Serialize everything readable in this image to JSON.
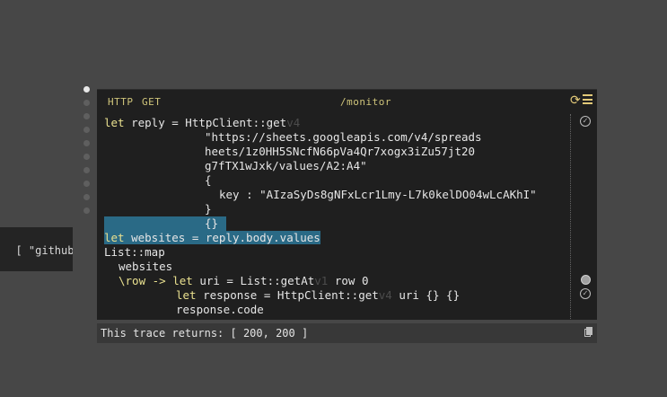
{
  "left_stub": {
    "text": "[ \"github.c"
  },
  "handler": {
    "method_type": "HTTP",
    "method": "GET",
    "route": "/monitor",
    "refresh_icon": "refresh-icon",
    "menu_icon": "hamburger-menu-icon"
  },
  "code": {
    "l1_kw": "let",
    "l1_name": " reply = HttpClient::get",
    "l1_ver": "v4",
    "l2": "\"https://sheets.googleapis.com/v4/spreads",
    "l3": "heets/1z0HH5SNcfN66pVa4Qr7xogx3iZu57jt20",
    "l4": "g7fTX1wJxk/values/A2:A4\"",
    "l5": "{",
    "l6_key": "key : ",
    "l6_val": "\"AIzaSyDs8gNFxLcr1Lmy-L7k0kelDO04wLcAKhI\"",
    "l7": "}",
    "l8": "{}",
    "l9_kw": "let",
    "l9_rest": " websites = reply.body.values",
    "l10": "List::map",
    "l11": "websites",
    "l12_lambda": "\\row -> ",
    "l12_kw": "let",
    "l12_rest": " uri = List::getAt",
    "l12_ver": "v1",
    "l12_tail": " row 0",
    "l13_kw": "let",
    "l13_rest": " response = HttpClient::get",
    "l13_ver": "v4",
    "l13_tail": " uri {} {}",
    "l14": "response.code"
  },
  "footer": {
    "trace_text": "This trace returns: [ 200, 200 ]",
    "copy_icon": "copy-icon"
  }
}
